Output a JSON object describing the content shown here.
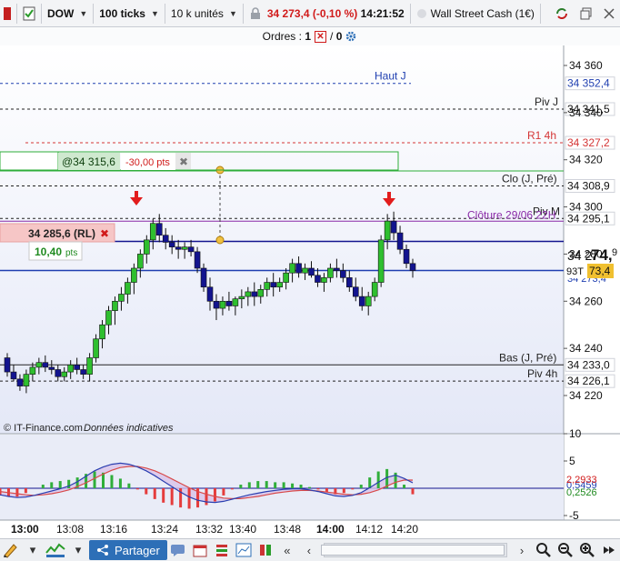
{
  "toolbar": {
    "instrument": "DOW",
    "timeframe": "100 ticks",
    "quantity": "10 k unités",
    "price": "34 273,4",
    "change": "(-0,10 %)",
    "time": "14:21:52",
    "market_name": "Wall Street Cash (1€)"
  },
  "orders": {
    "label": "Ordres :",
    "count_a": "1",
    "separator": "/",
    "count_b": "0"
  },
  "chart": {
    "footer_source": "© IT-Finance.com",
    "footer_note": "Données indicatives",
    "price_axis_ticks": [
      "34 360",
      "34 340",
      "34 320",
      "34 300",
      "34 280",
      "34 260",
      "34 240",
      "34 220"
    ],
    "time_axis_ticks": [
      "13:00",
      "13:08",
      "13:16",
      "13:24",
      "13:32",
      "13:40",
      "13:48",
      "14:00",
      "14:12",
      "14:20"
    ],
    "levels": {
      "haut_j": {
        "label": "Haut J",
        "value": "34 352,4"
      },
      "piv_j": {
        "label": "Piv J",
        "value": "34 341,5"
      },
      "r1_4h": {
        "label": "R1 4h",
        "value": "34 327,2"
      },
      "clo_j_pre": {
        "label": "Clo (J, Pré)",
        "value": "34 308,9"
      },
      "piv_m": {
        "label": "Piv M",
        "value": "34 295,1"
      },
      "cloture": {
        "label": "Clôture 29/06 22H"
      },
      "bas_j_pre": {
        "label": "Bas (J, Pré)",
        "value": "34 233,0"
      },
      "piv_4h": {
        "label": "Piv 4h",
        "value": "34 226,1"
      }
    },
    "current_price": {
      "big_prefix": "34 2",
      "big_main": "74,",
      "big_suffix": "9",
      "tag": "93T",
      "tag_value": "73,4",
      "hidden": "34 273,4"
    },
    "order_stop": {
      "price": "@34 315,6",
      "distance": "-30,00 pts"
    },
    "position": {
      "price": "34 285,6 (RL)",
      "pnl": "10,40",
      "pnl_unit": "pts"
    },
    "indicator_axis": [
      "10",
      "5",
      "-5"
    ],
    "indicator_values": [
      "0,5459",
      "2,2933",
      "0,2526"
    ],
    "colors": {
      "bull": "#2fbf2f",
      "bear": "#13148f",
      "loss": "#e53c3c",
      "gain": "#2fae3a",
      "level_dark": "#222222",
      "level_red": "#d43535",
      "level_purple": "#8a2aa8",
      "level_blue": "#1f3fb0"
    },
    "candles_ohlc": [
      [
        34236,
        34238,
        34228,
        34230
      ],
      [
        34230,
        34233,
        34226,
        34227
      ],
      [
        34227,
        34229,
        34222,
        34224
      ],
      [
        34224,
        34231,
        34221,
        34229
      ],
      [
        34229,
        34234,
        34226,
        34232
      ],
      [
        34232,
        34236,
        34229,
        34234
      ],
      [
        34234,
        34237,
        34230,
        34232
      ],
      [
        34232,
        34235,
        34229,
        34231
      ],
      [
        34231,
        34233,
        34226,
        34228
      ],
      [
        34228,
        34232,
        34226,
        34230
      ],
      [
        34230,
        34235,
        34227,
        34233
      ],
      [
        34233,
        34236,
        34229,
        34231
      ],
      [
        34231,
        34233,
        34227,
        34229
      ],
      [
        34229,
        34238,
        34226,
        34236
      ],
      [
        34236,
        34246,
        34234,
        34244
      ],
      [
        34244,
        34252,
        34240,
        34250
      ],
      [
        34250,
        34258,
        34246,
        34256
      ],
      [
        34256,
        34262,
        34250,
        34260
      ],
      [
        34260,
        34266,
        34256,
        34263
      ],
      [
        34263,
        34270,
        34259,
        34268
      ],
      [
        34268,
        34276,
        34263,
        34274
      ],
      [
        34274,
        34282,
        34270,
        34280
      ],
      [
        34280,
        34288,
        34276,
        34286
      ],
      [
        34286,
        34295,
        34282,
        34293
      ],
      [
        34293,
        34297,
        34285,
        34288
      ],
      [
        34288,
        34291,
        34282,
        34285
      ],
      [
        34285,
        34288,
        34280,
        34283
      ],
      [
        34283,
        34286,
        34278,
        34282
      ],
      [
        34282,
        34285,
        34278,
        34283
      ],
      [
        34283,
        34286,
        34279,
        34281
      ],
      [
        34281,
        34283,
        34272,
        34274
      ],
      [
        34274,
        34276,
        34264,
        34266
      ],
      [
        34266,
        34270,
        34256,
        34260
      ],
      [
        34260,
        34263,
        34252,
        34257
      ],
      [
        34257,
        34262,
        34254,
        34260
      ],
      [
        34260,
        34264,
        34256,
        34258
      ],
      [
        34258,
        34262,
        34254,
        34261
      ],
      [
        34261,
        34265,
        34257,
        34262
      ],
      [
        34262,
        34266,
        34258,
        34264
      ],
      [
        34264,
        34268,
        34258,
        34262
      ],
      [
        34262,
        34267,
        34259,
        34265
      ],
      [
        34265,
        34270,
        34262,
        34268
      ],
      [
        34268,
        34272,
        34262,
        34266
      ],
      [
        34266,
        34270,
        34264,
        34268
      ],
      [
        34268,
        34274,
        34265,
        34272
      ],
      [
        34272,
        34278,
        34268,
        34276
      ],
      [
        34276,
        34279,
        34270,
        34272
      ],
      [
        34272,
        34276,
        34269,
        34274
      ],
      [
        34274,
        34277,
        34270,
        34271
      ],
      [
        34271,
        34274,
        34266,
        34268
      ],
      [
        34268,
        34272,
        34264,
        34270
      ],
      [
        34270,
        34276,
        34268,
        34274
      ],
      [
        34274,
        34278,
        34270,
        34273
      ],
      [
        34273,
        34276,
        34268,
        34270
      ],
      [
        34270,
        34273,
        34264,
        34266
      ],
      [
        34266,
        34270,
        34260,
        34262
      ],
      [
        34262,
        34266,
        34256,
        34258
      ],
      [
        34258,
        34264,
        34254,
        34262
      ],
      [
        34262,
        34270,
        34260,
        34268
      ],
      [
        34268,
        34288,
        34266,
        34286
      ],
      [
        34286,
        34297,
        34282,
        34294
      ],
      [
        34294,
        34298,
        34286,
        34289
      ],
      [
        34289,
        34292,
        34280,
        34282
      ],
      [
        34282,
        34284,
        34274,
        34276
      ],
      [
        34276,
        34278,
        34270,
        34273
      ]
    ],
    "macd": [
      -1.2,
      -1.5,
      -1.7,
      -1.6,
      -1.3,
      -0.9,
      -0.5,
      -0.1,
      0.4,
      1.2,
      2.2,
      3.2,
      3.9,
      4.4,
      4.6,
      4.4,
      3.9,
      3.2,
      2.3,
      1.3,
      0.3,
      -0.7,
      -1.6,
      -2.2,
      -2.5,
      -2.6,
      -2.4,
      -2.0,
      -1.6,
      -1.2,
      -0.9,
      -0.6,
      -0.4,
      -0.2,
      -0.1,
      -0.1,
      -0.3,
      -0.6,
      -1.0,
      -1.4,
      -1.5,
      -1.3,
      -0.8,
      0.1,
      1.1,
      2.0,
      2.4,
      1.8,
      1.0
    ],
    "signal": [
      -0.6,
      -0.8,
      -1.0,
      -1.2,
      -1.3,
      -1.2,
      -1.0,
      -0.7,
      -0.3,
      0.3,
      1.0,
      1.8,
      2.6,
      3.3,
      3.8,
      4.0,
      4.0,
      3.7,
      3.2,
      2.5,
      1.7,
      0.9,
      0.1,
      -0.6,
      -1.1,
      -1.5,
      -1.8,
      -1.9,
      -1.9,
      -1.7,
      -1.5,
      -1.2,
      -0.9,
      -0.7,
      -0.5,
      -0.4,
      -0.4,
      -0.5,
      -0.7,
      -0.9,
      -1.1,
      -1.2,
      -1.1,
      -0.8,
      -0.3,
      0.4,
      1.1,
      1.5,
      1.5
    ]
  },
  "bottombar": {
    "share_label": "Partager"
  }
}
